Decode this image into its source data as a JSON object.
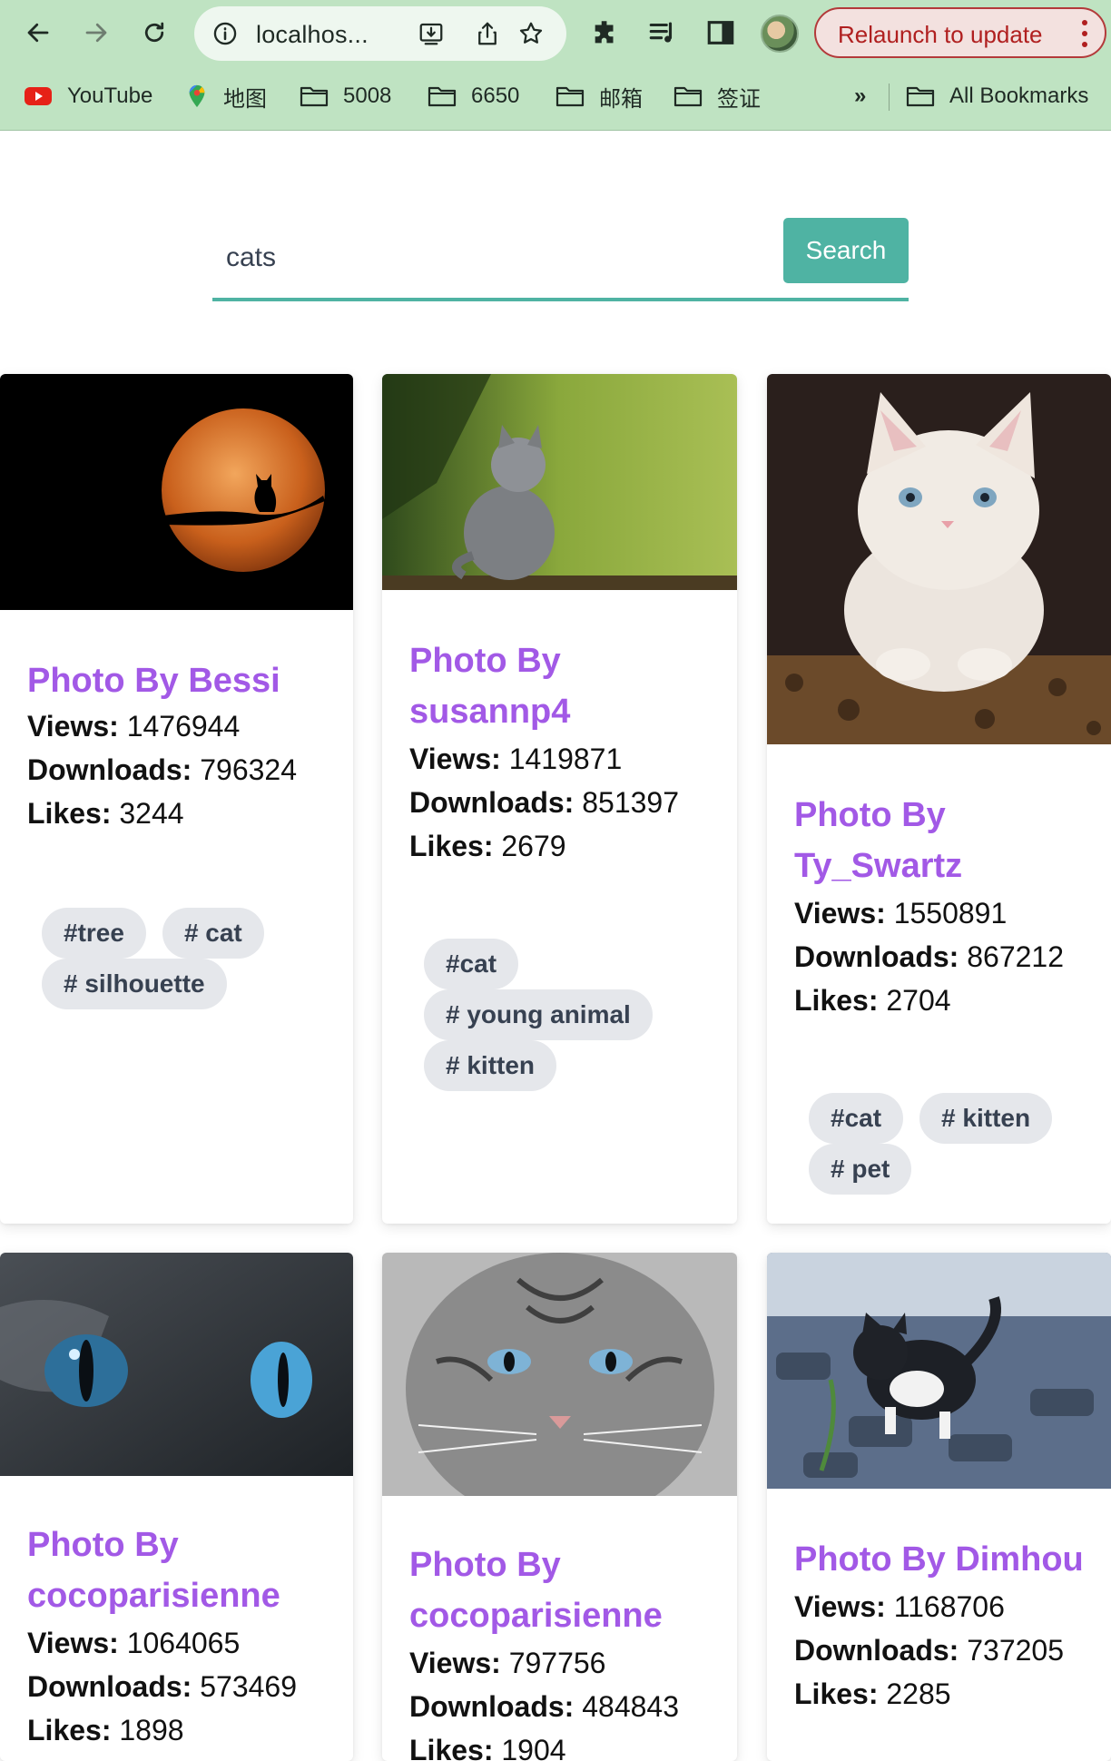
{
  "browser": {
    "url": "localhos...",
    "relaunch_label": "Relaunch to update",
    "bookmarks": [
      {
        "label": "YouTube",
        "icon": "youtube-icon"
      },
      {
        "label": "地图",
        "icon": "maps-icon"
      },
      {
        "label": "5008",
        "icon": "folder-icon"
      },
      {
        "label": "6650",
        "icon": "folder-icon"
      },
      {
        "label": "邮箱",
        "icon": "folder-icon"
      },
      {
        "label": "签证",
        "icon": "folder-icon"
      }
    ],
    "more_bookmarks": "»",
    "all_bookmarks": "All Bookmarks"
  },
  "search": {
    "value": "cats",
    "button_label": "Search"
  },
  "labels": {
    "views": "Views:",
    "downloads": "Downloads:",
    "likes": "Likes:"
  },
  "photos": [
    {
      "title": "Photo By Bessi",
      "views": "1476944",
      "downloads": "796324",
      "likes": "3244",
      "tags": [
        "#tree",
        "# cat",
        "# silhouette"
      ]
    },
    {
      "title": "Photo By susannp4",
      "views": "1419871",
      "downloads": "851397",
      "likes": "2679",
      "tags": [
        "#cat",
        "# young animal",
        "# kitten"
      ]
    },
    {
      "title": "Photo By Ty_Swartz",
      "views": "1550891",
      "downloads": "867212",
      "likes": "2704",
      "tags": [
        "#cat",
        "# kitten",
        "# pet"
      ]
    },
    {
      "title": "Photo By cocoparisienne",
      "views": "1064065",
      "downloads": "573469",
      "likes": "1898",
      "tags": []
    },
    {
      "title": "Photo By cocoparisienne",
      "views": "797756",
      "downloads": "484843",
      "likes": "1904",
      "tags": []
    },
    {
      "title": "Photo By Dimhou",
      "views": "1168706",
      "downloads": "737205",
      "likes": "2285",
      "tags": []
    }
  ],
  "colors": {
    "accent": "#4fb3a3",
    "title": "#a259e6",
    "chrome": "#bfe3c2",
    "relaunch": "#b01f1f"
  }
}
